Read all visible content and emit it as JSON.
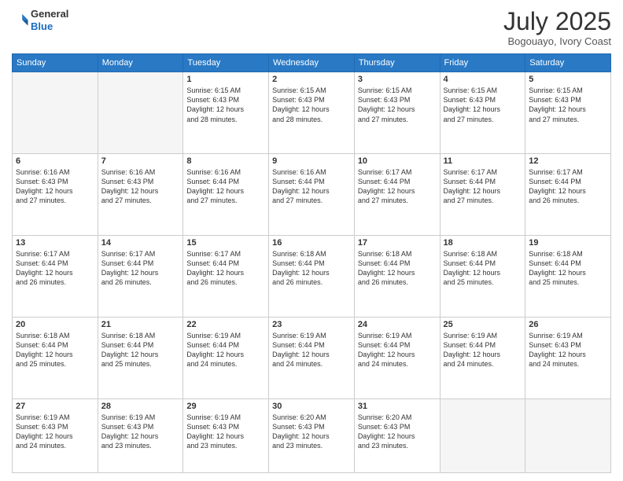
{
  "logo": {
    "line1": "General",
    "line2": "Blue"
  },
  "title": "July 2025",
  "location": "Bogouayo, Ivory Coast",
  "weekdays": [
    "Sunday",
    "Monday",
    "Tuesday",
    "Wednesday",
    "Thursday",
    "Friday",
    "Saturday"
  ],
  "weeks": [
    [
      {
        "day": "",
        "info": ""
      },
      {
        "day": "",
        "info": ""
      },
      {
        "day": "1",
        "info": "Sunrise: 6:15 AM\nSunset: 6:43 PM\nDaylight: 12 hours\nand 28 minutes."
      },
      {
        "day": "2",
        "info": "Sunrise: 6:15 AM\nSunset: 6:43 PM\nDaylight: 12 hours\nand 28 minutes."
      },
      {
        "day": "3",
        "info": "Sunrise: 6:15 AM\nSunset: 6:43 PM\nDaylight: 12 hours\nand 27 minutes."
      },
      {
        "day": "4",
        "info": "Sunrise: 6:15 AM\nSunset: 6:43 PM\nDaylight: 12 hours\nand 27 minutes."
      },
      {
        "day": "5",
        "info": "Sunrise: 6:15 AM\nSunset: 6:43 PM\nDaylight: 12 hours\nand 27 minutes."
      }
    ],
    [
      {
        "day": "6",
        "info": "Sunrise: 6:16 AM\nSunset: 6:43 PM\nDaylight: 12 hours\nand 27 minutes."
      },
      {
        "day": "7",
        "info": "Sunrise: 6:16 AM\nSunset: 6:43 PM\nDaylight: 12 hours\nand 27 minutes."
      },
      {
        "day": "8",
        "info": "Sunrise: 6:16 AM\nSunset: 6:44 PM\nDaylight: 12 hours\nand 27 minutes."
      },
      {
        "day": "9",
        "info": "Sunrise: 6:16 AM\nSunset: 6:44 PM\nDaylight: 12 hours\nand 27 minutes."
      },
      {
        "day": "10",
        "info": "Sunrise: 6:17 AM\nSunset: 6:44 PM\nDaylight: 12 hours\nand 27 minutes."
      },
      {
        "day": "11",
        "info": "Sunrise: 6:17 AM\nSunset: 6:44 PM\nDaylight: 12 hours\nand 27 minutes."
      },
      {
        "day": "12",
        "info": "Sunrise: 6:17 AM\nSunset: 6:44 PM\nDaylight: 12 hours\nand 26 minutes."
      }
    ],
    [
      {
        "day": "13",
        "info": "Sunrise: 6:17 AM\nSunset: 6:44 PM\nDaylight: 12 hours\nand 26 minutes."
      },
      {
        "day": "14",
        "info": "Sunrise: 6:17 AM\nSunset: 6:44 PM\nDaylight: 12 hours\nand 26 minutes."
      },
      {
        "day": "15",
        "info": "Sunrise: 6:17 AM\nSunset: 6:44 PM\nDaylight: 12 hours\nand 26 minutes."
      },
      {
        "day": "16",
        "info": "Sunrise: 6:18 AM\nSunset: 6:44 PM\nDaylight: 12 hours\nand 26 minutes."
      },
      {
        "day": "17",
        "info": "Sunrise: 6:18 AM\nSunset: 6:44 PM\nDaylight: 12 hours\nand 26 minutes."
      },
      {
        "day": "18",
        "info": "Sunrise: 6:18 AM\nSunset: 6:44 PM\nDaylight: 12 hours\nand 25 minutes."
      },
      {
        "day": "19",
        "info": "Sunrise: 6:18 AM\nSunset: 6:44 PM\nDaylight: 12 hours\nand 25 minutes."
      }
    ],
    [
      {
        "day": "20",
        "info": "Sunrise: 6:18 AM\nSunset: 6:44 PM\nDaylight: 12 hours\nand 25 minutes."
      },
      {
        "day": "21",
        "info": "Sunrise: 6:18 AM\nSunset: 6:44 PM\nDaylight: 12 hours\nand 25 minutes."
      },
      {
        "day": "22",
        "info": "Sunrise: 6:19 AM\nSunset: 6:44 PM\nDaylight: 12 hours\nand 24 minutes."
      },
      {
        "day": "23",
        "info": "Sunrise: 6:19 AM\nSunset: 6:44 PM\nDaylight: 12 hours\nand 24 minutes."
      },
      {
        "day": "24",
        "info": "Sunrise: 6:19 AM\nSunset: 6:44 PM\nDaylight: 12 hours\nand 24 minutes."
      },
      {
        "day": "25",
        "info": "Sunrise: 6:19 AM\nSunset: 6:44 PM\nDaylight: 12 hours\nand 24 minutes."
      },
      {
        "day": "26",
        "info": "Sunrise: 6:19 AM\nSunset: 6:43 PM\nDaylight: 12 hours\nand 24 minutes."
      }
    ],
    [
      {
        "day": "27",
        "info": "Sunrise: 6:19 AM\nSunset: 6:43 PM\nDaylight: 12 hours\nand 24 minutes."
      },
      {
        "day": "28",
        "info": "Sunrise: 6:19 AM\nSunset: 6:43 PM\nDaylight: 12 hours\nand 23 minutes."
      },
      {
        "day": "29",
        "info": "Sunrise: 6:19 AM\nSunset: 6:43 PM\nDaylight: 12 hours\nand 23 minutes."
      },
      {
        "day": "30",
        "info": "Sunrise: 6:20 AM\nSunset: 6:43 PM\nDaylight: 12 hours\nand 23 minutes."
      },
      {
        "day": "31",
        "info": "Sunrise: 6:20 AM\nSunset: 6:43 PM\nDaylight: 12 hours\nand 23 minutes."
      },
      {
        "day": "",
        "info": ""
      },
      {
        "day": "",
        "info": ""
      }
    ]
  ]
}
